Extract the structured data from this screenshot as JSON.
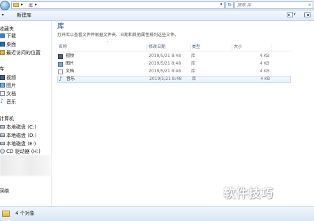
{
  "address_bar": {
    "path": [
      "库"
    ],
    "search_placeholder": "搜索 库"
  },
  "toolbar": {
    "new_library_label": "新建库"
  },
  "sidebar": {
    "favorites_header": "收藏夹",
    "favorites": [
      {
        "label": "下载",
        "icon": "download-icon"
      },
      {
        "label": "桌面",
        "icon": "desktop-icon"
      },
      {
        "label": "最近访问的位置",
        "icon": "recent-places-icon"
      }
    ],
    "libraries_header": "库",
    "libraries": [
      {
        "label": "视频",
        "icon": "video-icon"
      },
      {
        "label": "图片",
        "icon": "image-icon"
      },
      {
        "label": "文档",
        "icon": "document-icon"
      },
      {
        "label": "音乐",
        "icon": "music-icon"
      }
    ],
    "computer_header": "计算机",
    "drives": [
      {
        "label": "本地磁盘 (C:)",
        "icon": "disk-icon"
      },
      {
        "label": "本地磁盘 (D:)",
        "icon": "disk-icon"
      },
      {
        "label": "本地磁盘 (E:)",
        "icon": "disk-icon"
      },
      {
        "label": "CD 驱动器 (H:)",
        "icon": "cd-drive-icon"
      }
    ],
    "network_header": "网络"
  },
  "main": {
    "title": "库",
    "description": "打开库以查看文件并根据文件夹、日期和其他属性排列这些文件。",
    "columns": [
      "名称",
      "修改日期",
      "类型",
      "大小"
    ],
    "rows": [
      {
        "name": "视频",
        "date": "2019/5/21 8:48",
        "type": "库",
        "size": "4 KB",
        "icon": "video-library-icon"
      },
      {
        "name": "图片",
        "date": "2019/5/21 8:48",
        "type": "库",
        "size": "4 KB",
        "icon": "image-library-icon"
      },
      {
        "name": "文档",
        "date": "2019/5/21 8:48",
        "type": "库",
        "size": "4 KB",
        "icon": "document-library-icon"
      },
      {
        "name": "音乐",
        "date": "2019/5/21 8:48",
        "type": "库",
        "size": "4 KB",
        "icon": "music-library-icon",
        "selected": true
      }
    ]
  },
  "status_bar": {
    "item_count": "4 个对象"
  },
  "watermark": "软件技巧",
  "colors": {
    "accent": "#1f4e8c",
    "selection": "#e6f1fb",
    "chrome": "#dde8f5"
  }
}
